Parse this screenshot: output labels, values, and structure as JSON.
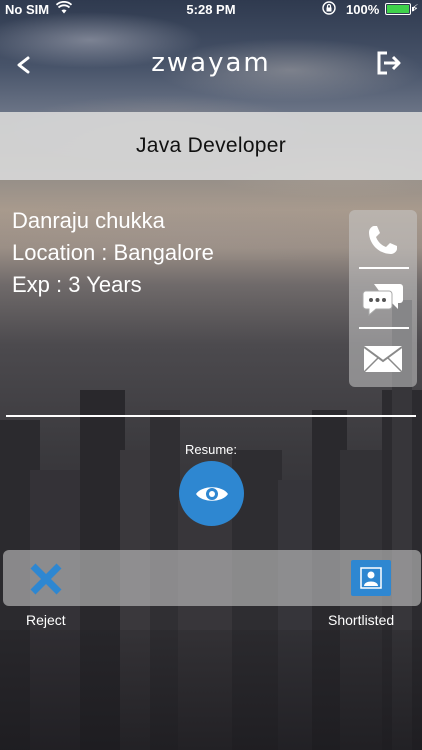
{
  "status_bar": {
    "carrier": "No SIM",
    "time": "5:28 PM",
    "battery": "100%"
  },
  "nav": {
    "back_icon": "<",
    "logo": "zwayam",
    "logout_icon": "logout-icon"
  },
  "job": {
    "title": "Java Developer"
  },
  "candidate": {
    "name": "Danraju chukka",
    "location": "Location : Bangalore",
    "experience": "Exp : 3 Years"
  },
  "contact_actions": [
    "phone-icon",
    "chat-icon",
    "mail-icon"
  ],
  "resume": {
    "label": "Resume:",
    "icon": "eye-icon"
  },
  "actions": {
    "reject_label": "Reject",
    "shortlist_label": "Shortlisted"
  },
  "colors": {
    "accent": "#2e87d1",
    "reject": "#2e87d1",
    "battery": "#3fd24b"
  }
}
